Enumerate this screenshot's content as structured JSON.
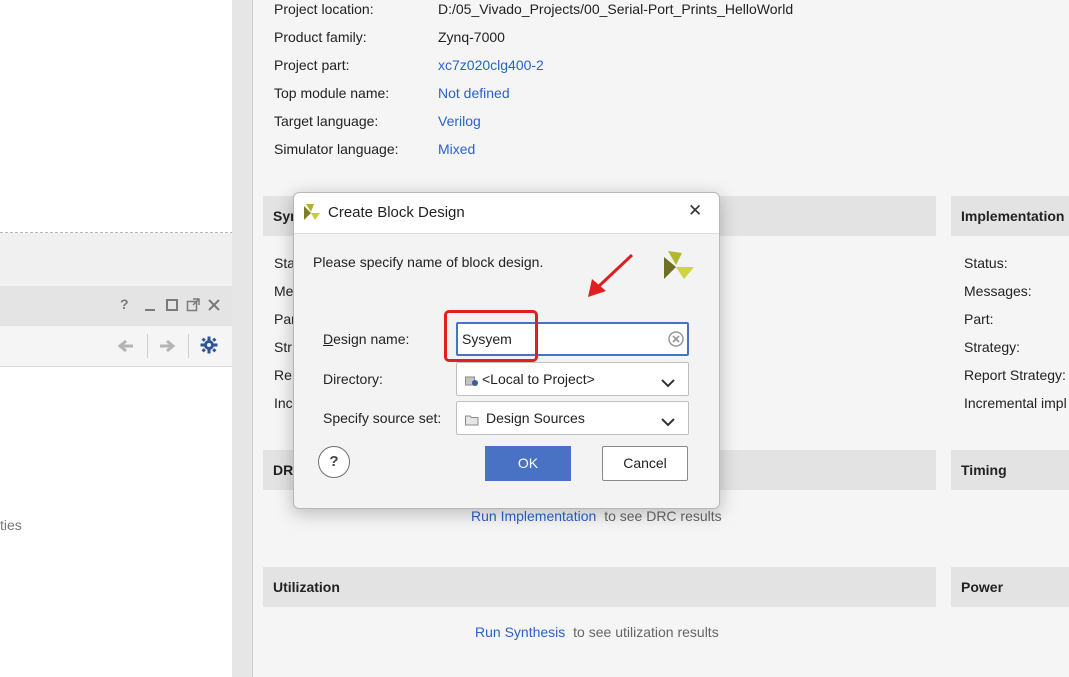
{
  "left": {
    "toolbar_help": "?",
    "partial_text": "ties"
  },
  "project_summary": {
    "rows": [
      {
        "label": "Project location:",
        "value": "D:/05_Vivado_Projects/00_Serial-Port_Prints_HelloWorld",
        "link": false
      },
      {
        "label": "Product family:",
        "value": "Zynq-7000",
        "link": false
      },
      {
        "label": "Project part:",
        "value": "xc7z020clg400-2",
        "link": true
      },
      {
        "label": "Top module name:",
        "value": "Not defined",
        "link": true
      },
      {
        "label": "Target language:",
        "value": "Verilog",
        "link": true
      },
      {
        "label": "Simulator language:",
        "value": "Mixed",
        "link": true
      }
    ]
  },
  "synthesis": {
    "title": "Synthesis",
    "title_partial": "Syr",
    "rows_partial": [
      "Sta",
      "Me",
      "Par",
      "Str",
      "Re",
      "Inc"
    ]
  },
  "implementation": {
    "title": "Implementation",
    "rows": [
      "Status:",
      "Messages:",
      "Part:",
      "Strategy:",
      "Report Strategy:",
      "Incremental impl"
    ]
  },
  "drc": {
    "title_partial": "DR",
    "link": "Run Implementation",
    "text": "to see DRC results"
  },
  "timing": {
    "title": "Timing"
  },
  "utilization": {
    "title": "Utilization",
    "link": "Run Synthesis",
    "text": "to see utilization results"
  },
  "power": {
    "title": "Power"
  },
  "dialog": {
    "title": "Create Block Design",
    "close": "✕",
    "prompt": "Please specify name of block design.",
    "design_name_label": "Design name:",
    "design_name_mnemonic": "D",
    "design_name_rest": "esign name:",
    "design_name_value": "Sysyem",
    "directory_label": "Directory:",
    "directory_value": "<Local to Project>",
    "source_set_label": "Specify source set:",
    "source_set_value": "Design Sources",
    "help": "?",
    "ok": "OK",
    "cancel": "Cancel"
  },
  "colors": {
    "accent": "#4a72c4",
    "link": "#2a62c9",
    "highlight": "#e02020"
  }
}
